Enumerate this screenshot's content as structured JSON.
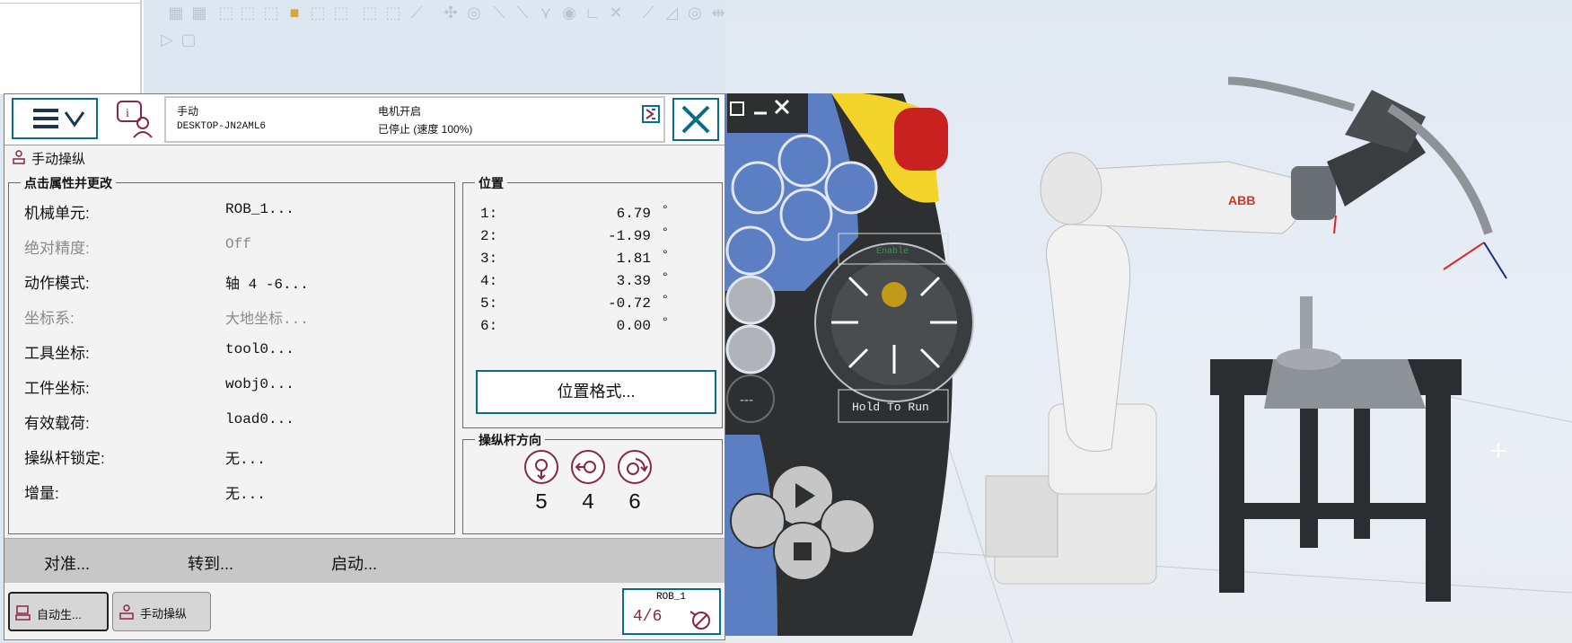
{
  "header": {
    "mode": "手动",
    "controller_name": "DESKTOP-JN2AML6",
    "motor_status": "电机开启",
    "run_status": "已停止 (速度 100%)"
  },
  "page_title": "手动操纵",
  "properties_group": {
    "title": "点击属性并更改",
    "items": [
      {
        "label": "机械单元:",
        "value": "ROB_1..."
      },
      {
        "label": "绝对精度:",
        "value": "Off"
      },
      {
        "label": "动作模式:",
        "value": "轴 4 -6..."
      },
      {
        "label": "坐标系:",
        "value": "大地坐标..."
      },
      {
        "label": "工具坐标:",
        "value": "tool0..."
      },
      {
        "label": "工件坐标:",
        "value": "wobj0..."
      },
      {
        "label": "有效载荷:",
        "value": "load0..."
      },
      {
        "label": "操纵杆锁定:",
        "value": "无..."
      },
      {
        "label": "增量:",
        "value": "无..."
      }
    ]
  },
  "position_group": {
    "title": "位置",
    "unit": "°",
    "rows": [
      {
        "axis": "1:",
        "value": "6.79"
      },
      {
        "axis": "2:",
        "value": "-1.99"
      },
      {
        "axis": "3:",
        "value": "1.81"
      },
      {
        "axis": "4:",
        "value": "3.39"
      },
      {
        "axis": "5:",
        "value": "-0.72"
      },
      {
        "axis": "6:",
        "value": "0.00"
      }
    ],
    "format_button": "位置格式..."
  },
  "joystick_group": {
    "title": "操纵杆方向",
    "directions": [
      "5",
      "4",
      "6"
    ]
  },
  "commands": {
    "align": "对准...",
    "goto": "转到...",
    "activate": "启动..."
  },
  "taskbar": {
    "task1": "自动生...",
    "task2": "手动操纵",
    "robot": "ROB_1",
    "fraction": "4/6"
  },
  "hardware": {
    "enable_label": "Enable",
    "hold_label": "Hold To Run"
  },
  "robot_brand": "ABB"
}
